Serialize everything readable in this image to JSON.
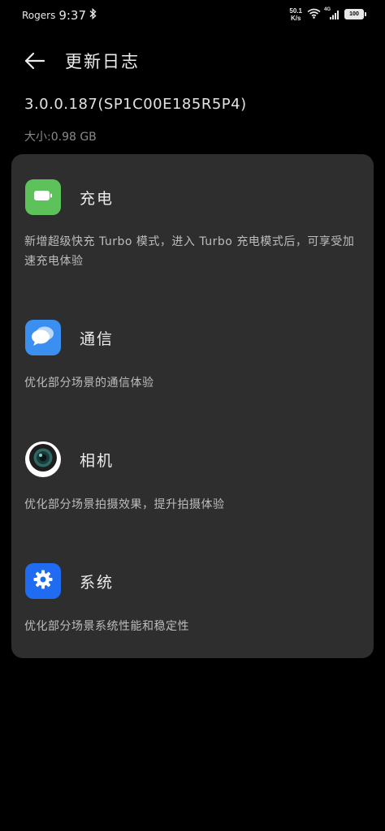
{
  "status_bar": {
    "carrier": "Rogers",
    "time": "9:37",
    "net_speed_value": "50.1",
    "net_speed_unit": "K/s",
    "network_type": "4G",
    "battery": "100"
  },
  "header": {
    "title": "更新日志"
  },
  "version": "3.0.0.187(SP1C00E185R5P4)",
  "size": "大小:0.98 GB",
  "sections": [
    {
      "title": "充电",
      "icon": "battery-icon",
      "color": "#5dc25a",
      "description": "新增超级快充 Turbo 模式，进入 Turbo 充电模式后，可享受加速充电体验"
    },
    {
      "title": "通信",
      "icon": "chat-bubbles-icon",
      "color": "#3a8ff0",
      "description": "优化部分场景的通信体验"
    },
    {
      "title": "相机",
      "icon": "camera-lens-icon",
      "color": "#ffffff",
      "description": "优化部分场景拍摄效果，提升拍摄体验"
    },
    {
      "title": "系统",
      "icon": "gear-icon",
      "color": "#1f6cf2",
      "description": "优化部分场景系统性能和稳定性"
    }
  ]
}
